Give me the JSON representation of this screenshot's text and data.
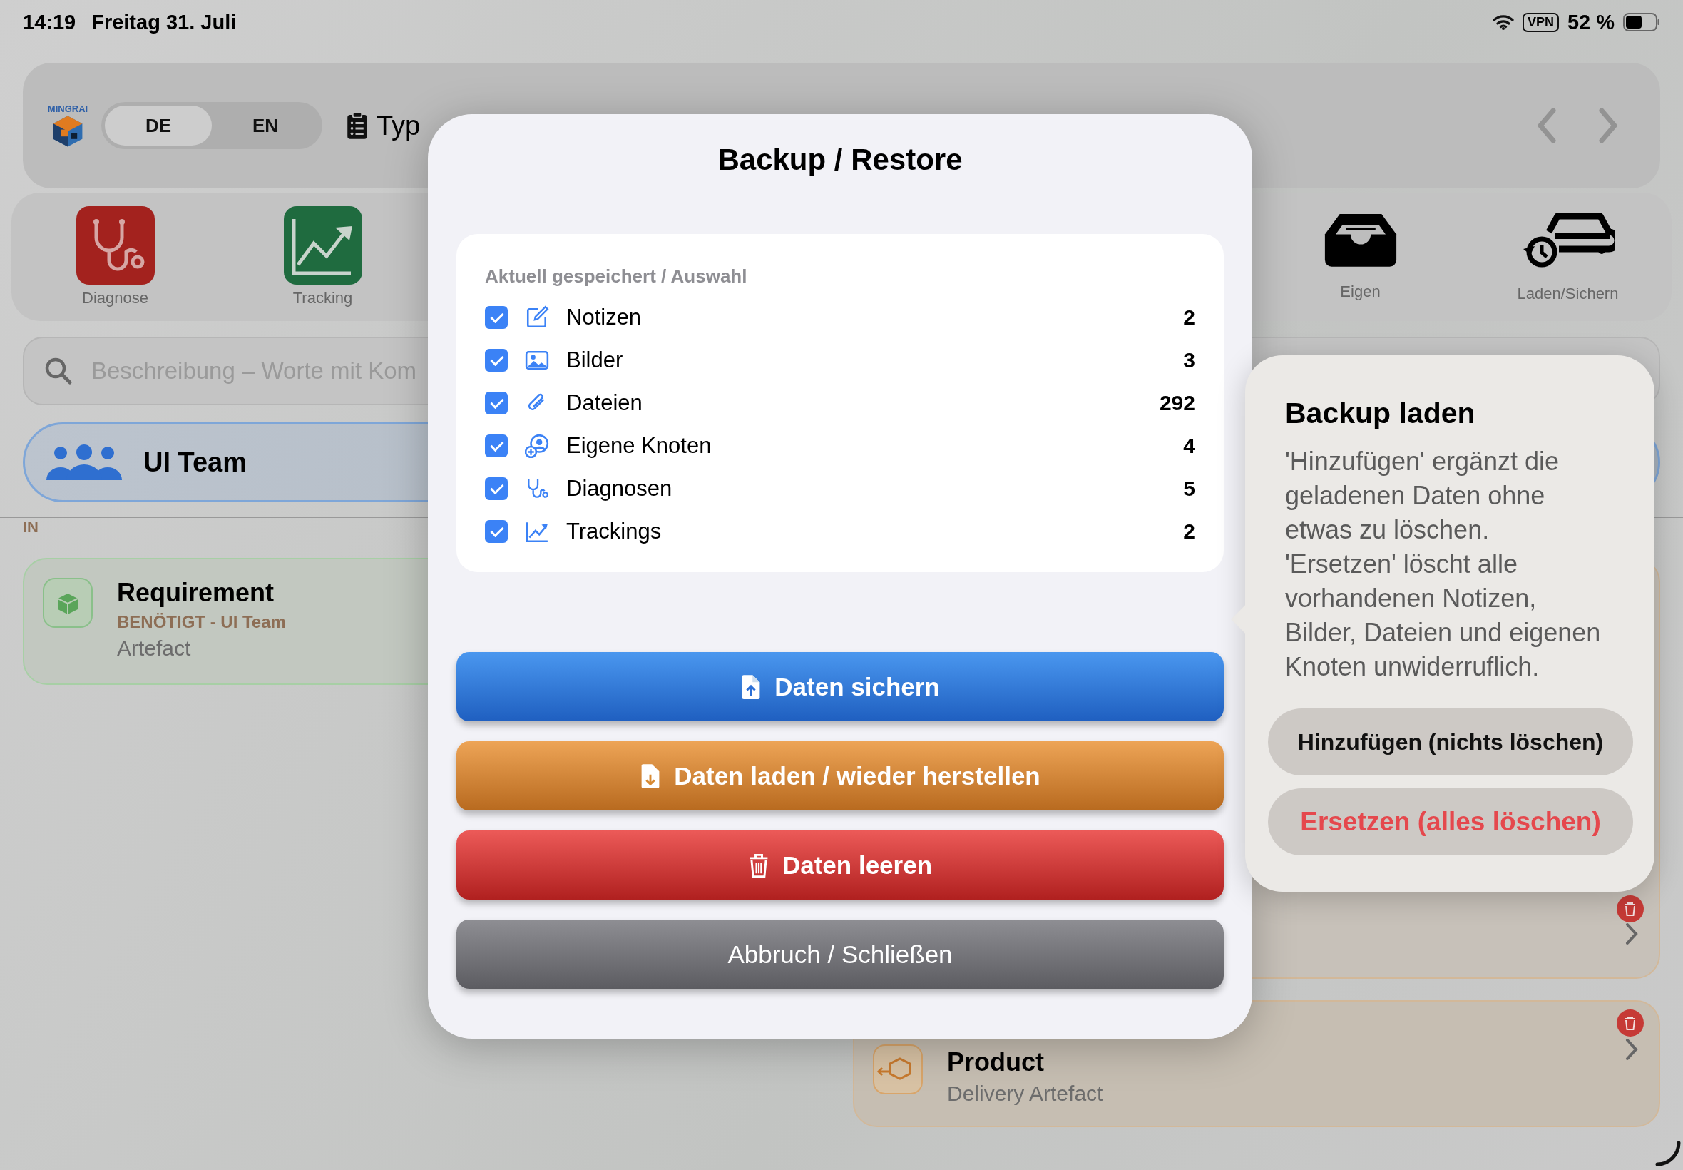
{
  "status_bar": {
    "time": "14:19",
    "date": "Freitag 31. Juli",
    "vpn": "VPN",
    "battery": "52 %"
  },
  "header": {
    "logo_text": "MINGRAI",
    "languages": [
      {
        "label": "DE",
        "selected": true
      },
      {
        "label": "EN",
        "selected": false
      }
    ],
    "type_label": "Typ"
  },
  "tiles": [
    {
      "label": "Diagnose",
      "kind": "diagnose"
    },
    {
      "label": "Tracking",
      "kind": "tracking"
    },
    {
      "label": "Eigen",
      "kind": "eigen"
    },
    {
      "label": "Laden/Sichern",
      "kind": "backup"
    }
  ],
  "search": {
    "placeholder": "Beschreibung – Worte mit Kom"
  },
  "team": {
    "name": "UI Team"
  },
  "section": {
    "label": "IN"
  },
  "cards": [
    {
      "kind": "requirement",
      "title": "Requirement",
      "relation": "BENÖTIGT - UI Team",
      "subtitle": "Artefact"
    },
    {
      "kind": "delivery",
      "title": "Product",
      "subtitle": "Delivery Artefact"
    }
  ],
  "dialog": {
    "title": "Backup / Restore",
    "section_title": "Aktuell gespeichert / Auswahl",
    "items": [
      {
        "kind": "notes",
        "label": "Notizen",
        "count": "2",
        "checked": true
      },
      {
        "kind": "images",
        "label": "Bilder",
        "count": "3",
        "checked": true
      },
      {
        "kind": "files",
        "label": "Dateien",
        "count": "292",
        "checked": true
      },
      {
        "kind": "nodes",
        "label": "Eigene Knoten",
        "count": "4",
        "checked": true
      },
      {
        "kind": "diagnoses",
        "label": "Diagnosen",
        "count": "5",
        "checked": true
      },
      {
        "kind": "trackings",
        "label": "Trackings",
        "count": "2",
        "checked": true
      }
    ],
    "buttons": [
      {
        "kind": "save",
        "label": "Daten sichern"
      },
      {
        "kind": "load",
        "label": "Daten laden / wieder herstellen"
      },
      {
        "kind": "clear",
        "label": "Daten leeren"
      },
      {
        "kind": "cancel",
        "label": "Abbruch / Schließen"
      }
    ]
  },
  "popover": {
    "title": "Backup laden",
    "message": "'Hinzufügen' ergänzt die geladenen Daten ohne etwas zu löschen. 'Ersetzen' löscht alle vorhandenen Notizen, Bilder, Dateien und eigenen Knoten unwiderruflich.",
    "actions": [
      {
        "kind": "add",
        "label": "Hinzufügen (nichts löschen)"
      },
      {
        "kind": "destructive",
        "label": "Ersetzen (alles löschen)"
      }
    ]
  }
}
